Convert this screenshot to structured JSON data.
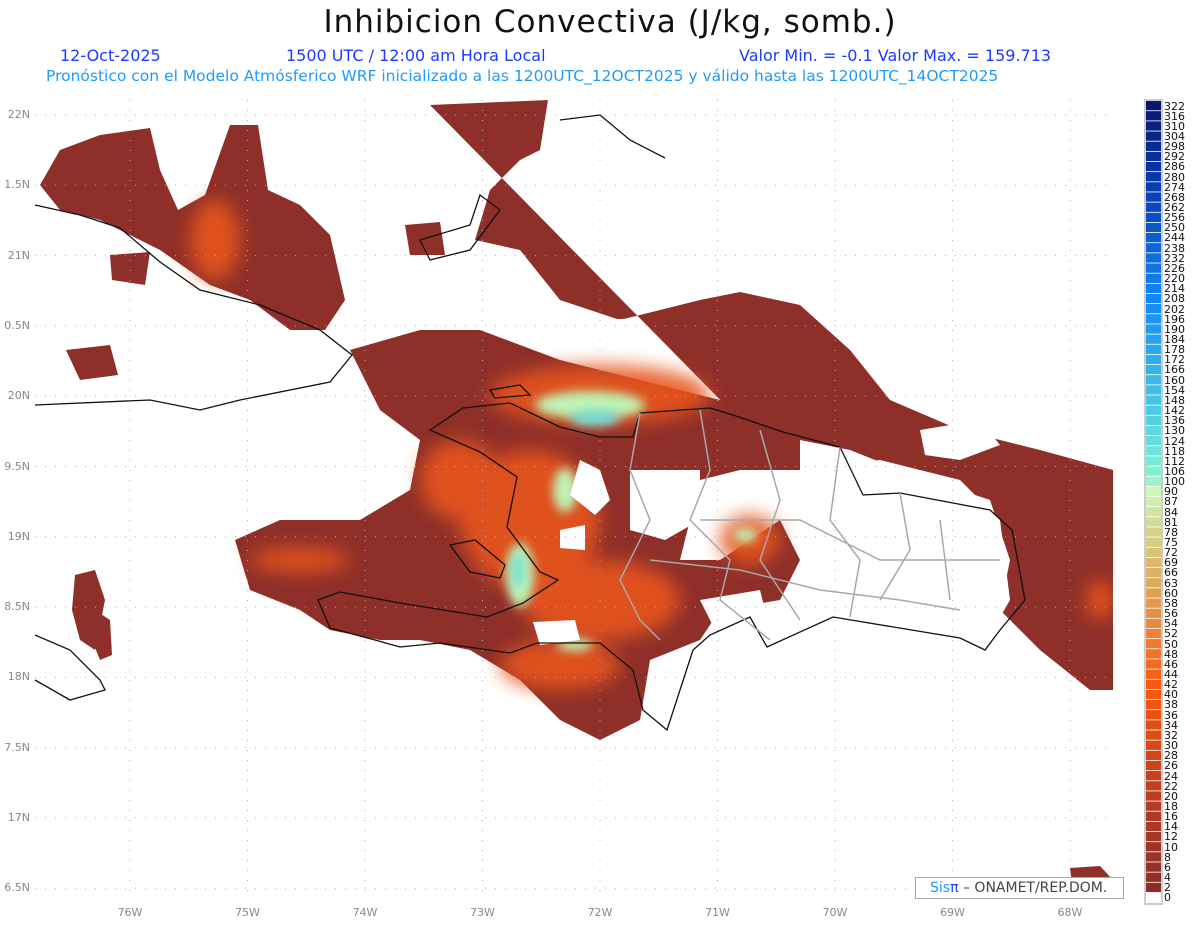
{
  "header": {
    "title": "Inhibicion Convectiva (J/kg, somb.)",
    "date": "12-Oct-2025",
    "time": "1500 UTC / 12:00 am Hora Local",
    "minmax": "Valor Min. = -0.1  Valor Max. = 159.713",
    "forecast": "Pronóstico con el Modelo Atmósferico WRF inicializado a las 1200UTC_12OCT2025 y válido hasta las  1200UTC_14OCT2025"
  },
  "axes": {
    "lat_labels": [
      "22N",
      "1.5N",
      "21N",
      "0.5N",
      "20N",
      "9.5N",
      "19N",
      "8.5N",
      "18N",
      "7.5N",
      "17N",
      "6.5N"
    ],
    "lon_labels": [
      "76W",
      "75W",
      "74W",
      "73W",
      "72W",
      "71W",
      "70W",
      "69W",
      "68W"
    ]
  },
  "colorbar": {
    "levels": [
      "322",
      "316",
      "310",
      "304",
      "298",
      "292",
      "286",
      "280",
      "274",
      "268",
      "262",
      "256",
      "250",
      "244",
      "238",
      "232",
      "226",
      "220",
      "214",
      "208",
      "202",
      "196",
      "190",
      "184",
      "178",
      "172",
      "166",
      "160",
      "154",
      "148",
      "142",
      "136",
      "130",
      "124",
      "118",
      "112",
      "106",
      "100",
      "90",
      "87",
      "84",
      "81",
      "78",
      "75",
      "72",
      "69",
      "66",
      "63",
      "60",
      "58",
      "56",
      "54",
      "52",
      "50",
      "48",
      "46",
      "44",
      "42",
      "40",
      "38",
      "36",
      "34",
      "32",
      "30",
      "28",
      "26",
      "24",
      "22",
      "20",
      "18",
      "16",
      "14",
      "12",
      "10",
      "8",
      "6",
      "4",
      "2",
      "0"
    ],
    "palette": [
      {
        "v": 322,
        "c": "#0a1670"
      },
      {
        "v": 262,
        "c": "#0848c0"
      },
      {
        "v": 208,
        "c": "#1288f5"
      },
      {
        "v": 148,
        "c": "#46c4e6"
      },
      {
        "v": 106,
        "c": "#80f0d2"
      },
      {
        "v": 90,
        "c": "#ccf8b8"
      },
      {
        "v": 78,
        "c": "#d6d488"
      },
      {
        "v": 63,
        "c": "#dcaa5c"
      },
      {
        "v": 50,
        "c": "#f07a30"
      },
      {
        "v": 42,
        "c": "#fa5a0e"
      },
      {
        "v": 30,
        "c": "#d84818"
      },
      {
        "v": 18,
        "c": "#b43c22"
      },
      {
        "v": 2,
        "c": "#8e2c2c"
      },
      {
        "v": 0,
        "c": "#ffffff"
      }
    ]
  },
  "colors": {
    "low": "#8e2f2a",
    "mid": "#e8541a",
    "high": "#bff3b4",
    "peak": "#74dcd8"
  },
  "credit": {
    "sis": "Sis",
    "pi": "π",
    "sep": " –  ",
    "org": "ONAMET/REP.DOM."
  }
}
